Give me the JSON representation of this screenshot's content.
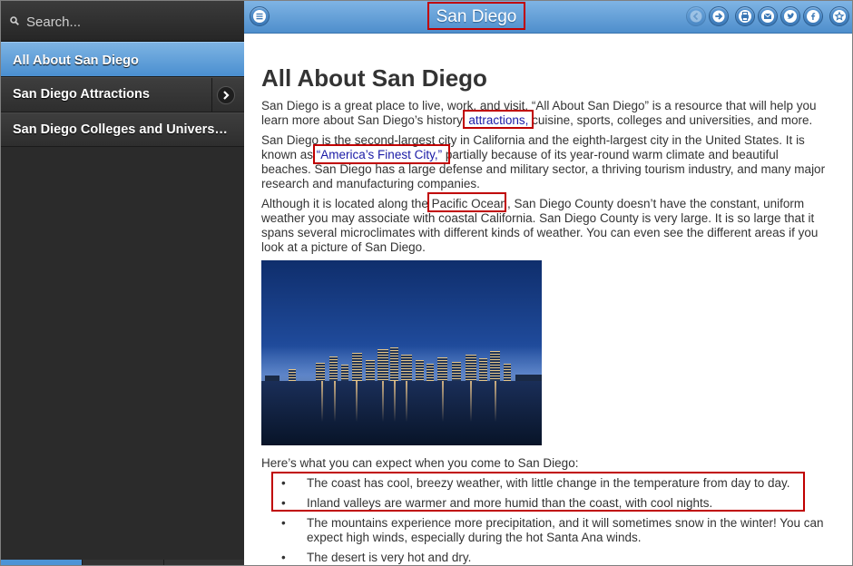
{
  "sidebar": {
    "search_placeholder": "Search...",
    "items": [
      {
        "label": "All About San Diego"
      },
      {
        "label": "San Diego Attractions"
      },
      {
        "label": "San Diego Colleges and Universities"
      }
    ]
  },
  "header": {
    "title": "San Diego",
    "buttons": [
      "menu-icon",
      "back-icon",
      "forward-icon",
      "print-icon",
      "mail-icon",
      "twitter-icon",
      "facebook-icon",
      "star-icon"
    ]
  },
  "content": {
    "heading": "All About San Diego",
    "p1_a": "San Diego is a great place to live, work, and visit. “All About San Diego” is a resource that will help you learn more about San Diego’s history, ",
    "p1_link": "attractions,",
    "p1_b": " cuisine, sports, colleges and universities, and more.",
    "p2_a": "San Diego is the second-largest city in California and the eighth-largest city in the United States. It is known as ",
    "p2_link": "“America’s Finest City,”",
    "p2_b": " partially because of its year-round warm climate and beautiful beaches. San Diego has a large defense and military sector, a thriving tourism industry, and many major research and manufacturing companies.",
    "p3_a": "Although it is located along the ",
    "p3_highlight": "Pacific Ocean",
    "p3_b": ", San Diego County doesn’t have the constant, uniform weather you may associate with coastal California. San Diego County is very large. It is so large that it spans several microclimates with different kinds of weather. You can even see the different areas if you look at a picture of San Diego.",
    "expect_intro": "Here’s what you can expect when you come to San Diego:",
    "bullet": "•",
    "list": [
      "The coast has cool, breezy weather, with little change in the temperature from day to day.",
      "Inland valleys are warmer and more humid than the coast, with cool nights.",
      "The mountains experience more precipitation, and it will sometimes snow in the winter! You can expect high winds, especially during the hot Santa Ana winds.",
      "The desert is very hot and dry."
    ]
  }
}
